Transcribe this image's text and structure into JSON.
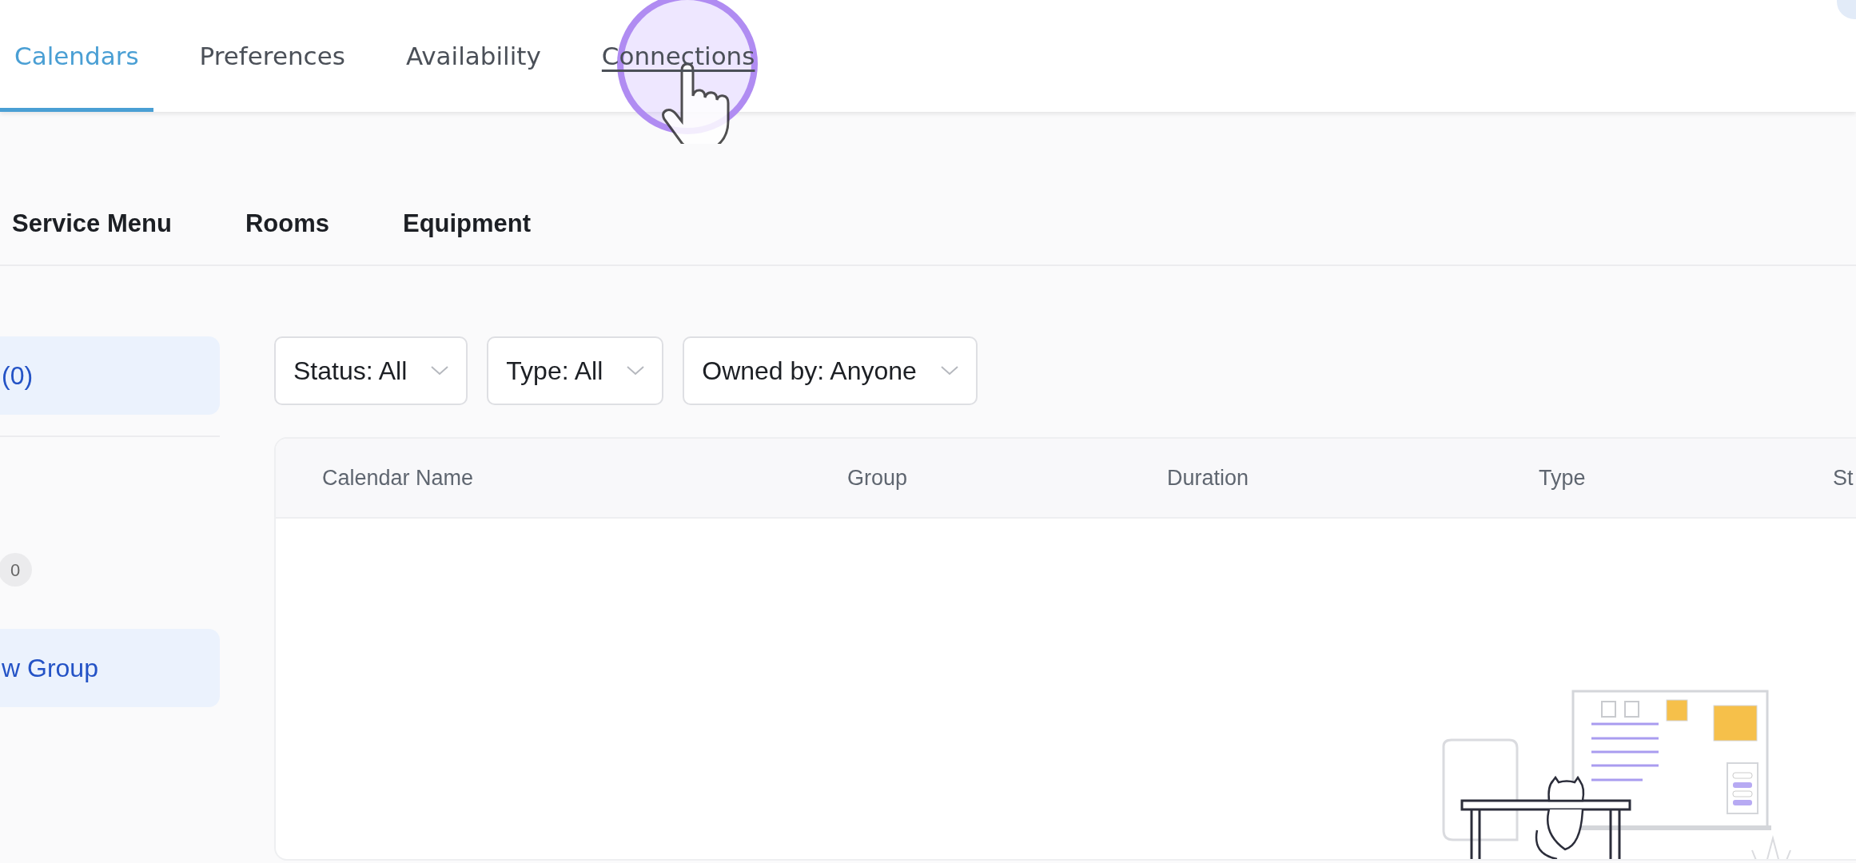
{
  "top_tabs": [
    {
      "label": "Calendars",
      "selected": true,
      "hovered": false
    },
    {
      "label": "Preferences",
      "selected": false,
      "hovered": false
    },
    {
      "label": "Availability",
      "selected": false,
      "hovered": false
    },
    {
      "label": "Connections",
      "selected": false,
      "hovered": true
    }
  ],
  "sub_tabs": [
    {
      "label": "Service Menu"
    },
    {
      "label": "Rooms"
    },
    {
      "label": "Equipment"
    }
  ],
  "sidebar": {
    "items": [
      {
        "kind": "filter",
        "label": "(0)"
      },
      {
        "kind": "count",
        "label": "0"
      },
      {
        "kind": "action",
        "label": "w Group"
      }
    ]
  },
  "filters": [
    {
      "label": "Status: All"
    },
    {
      "label": "Type: All"
    },
    {
      "label": "Owned by: Anyone"
    }
  ],
  "table": {
    "columns": [
      "Calendar Name",
      "Group",
      "Duration",
      "Type",
      "St"
    ]
  }
}
